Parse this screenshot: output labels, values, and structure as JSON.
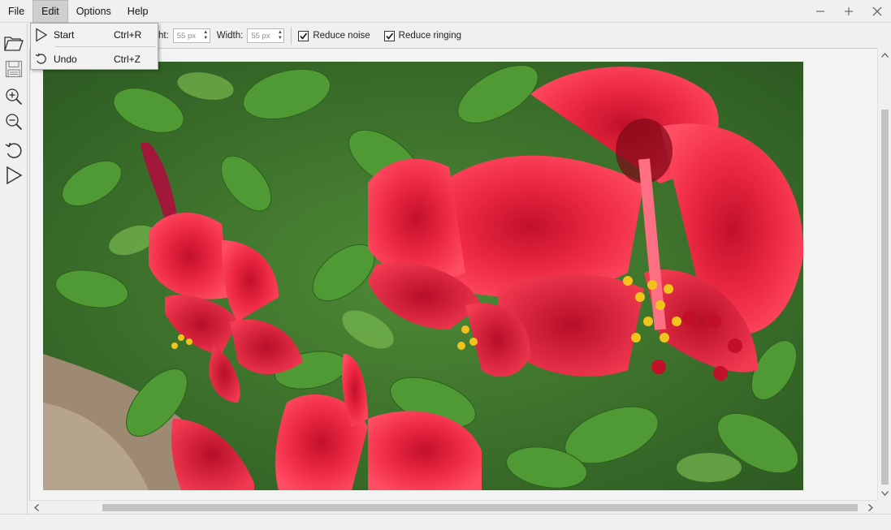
{
  "menubar": {
    "items": [
      "File",
      "Edit",
      "Options",
      "Help"
    ],
    "active": "Edit"
  },
  "window_controls": [
    "minimize",
    "maximize",
    "close"
  ],
  "toolbar": {
    "height_label": "ight:",
    "height_value": "55 px",
    "width_label": "Width:",
    "width_value": "55 px",
    "reduce_noise_label": "Reduce noise",
    "reduce_noise_checked": true,
    "reduce_ringing_label": "Reduce ringing",
    "reduce_ringing_checked": true
  },
  "left_tools": [
    "open-folder-icon",
    "save-icon",
    "zoom-in-icon",
    "zoom-out-icon",
    "undo-icon",
    "start-icon"
  ],
  "edit_menu": {
    "items": [
      {
        "label": "Start",
        "shortcut": "Ctrl+R",
        "icon": "play-icon"
      },
      {
        "label": "Undo",
        "shortcut": "Ctrl+Z",
        "icon": "undo-icon"
      }
    ]
  },
  "colors": {
    "chrome": "#f0f0f0",
    "canvas": "#f3f3f3",
    "flower_red": "#e8203a",
    "leaf_green": "#3d7a2c",
    "stamen_yellow": "#f2c31c"
  }
}
